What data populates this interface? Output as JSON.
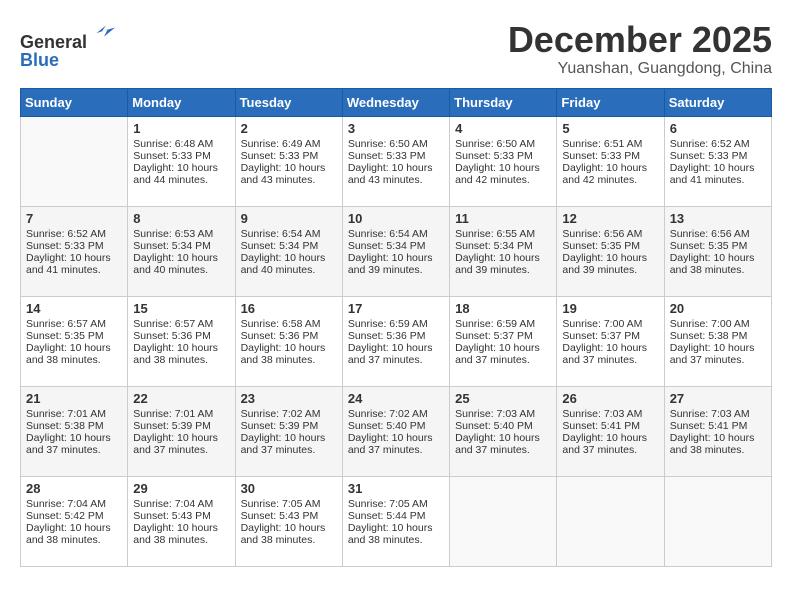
{
  "header": {
    "logo_line1": "General",
    "logo_line2": "Blue",
    "month": "December 2025",
    "location": "Yuanshan, Guangdong, China"
  },
  "weekdays": [
    "Sunday",
    "Monday",
    "Tuesday",
    "Wednesday",
    "Thursday",
    "Friday",
    "Saturday"
  ],
  "weeks": [
    [
      {
        "day": "",
        "info": ""
      },
      {
        "day": "1",
        "info": "Sunrise: 6:48 AM\nSunset: 5:33 PM\nDaylight: 10 hours\nand 44 minutes."
      },
      {
        "day": "2",
        "info": "Sunrise: 6:49 AM\nSunset: 5:33 PM\nDaylight: 10 hours\nand 43 minutes."
      },
      {
        "day": "3",
        "info": "Sunrise: 6:50 AM\nSunset: 5:33 PM\nDaylight: 10 hours\nand 43 minutes."
      },
      {
        "day": "4",
        "info": "Sunrise: 6:50 AM\nSunset: 5:33 PM\nDaylight: 10 hours\nand 42 minutes."
      },
      {
        "day": "5",
        "info": "Sunrise: 6:51 AM\nSunset: 5:33 PM\nDaylight: 10 hours\nand 42 minutes."
      },
      {
        "day": "6",
        "info": "Sunrise: 6:52 AM\nSunset: 5:33 PM\nDaylight: 10 hours\nand 41 minutes."
      }
    ],
    [
      {
        "day": "7",
        "info": "Sunrise: 6:52 AM\nSunset: 5:33 PM\nDaylight: 10 hours\nand 41 minutes."
      },
      {
        "day": "8",
        "info": "Sunrise: 6:53 AM\nSunset: 5:34 PM\nDaylight: 10 hours\nand 40 minutes."
      },
      {
        "day": "9",
        "info": "Sunrise: 6:54 AM\nSunset: 5:34 PM\nDaylight: 10 hours\nand 40 minutes."
      },
      {
        "day": "10",
        "info": "Sunrise: 6:54 AM\nSunset: 5:34 PM\nDaylight: 10 hours\nand 39 minutes."
      },
      {
        "day": "11",
        "info": "Sunrise: 6:55 AM\nSunset: 5:34 PM\nDaylight: 10 hours\nand 39 minutes."
      },
      {
        "day": "12",
        "info": "Sunrise: 6:56 AM\nSunset: 5:35 PM\nDaylight: 10 hours\nand 39 minutes."
      },
      {
        "day": "13",
        "info": "Sunrise: 6:56 AM\nSunset: 5:35 PM\nDaylight: 10 hours\nand 38 minutes."
      }
    ],
    [
      {
        "day": "14",
        "info": "Sunrise: 6:57 AM\nSunset: 5:35 PM\nDaylight: 10 hours\nand 38 minutes."
      },
      {
        "day": "15",
        "info": "Sunrise: 6:57 AM\nSunset: 5:36 PM\nDaylight: 10 hours\nand 38 minutes."
      },
      {
        "day": "16",
        "info": "Sunrise: 6:58 AM\nSunset: 5:36 PM\nDaylight: 10 hours\nand 38 minutes."
      },
      {
        "day": "17",
        "info": "Sunrise: 6:59 AM\nSunset: 5:36 PM\nDaylight: 10 hours\nand 37 minutes."
      },
      {
        "day": "18",
        "info": "Sunrise: 6:59 AM\nSunset: 5:37 PM\nDaylight: 10 hours\nand 37 minutes."
      },
      {
        "day": "19",
        "info": "Sunrise: 7:00 AM\nSunset: 5:37 PM\nDaylight: 10 hours\nand 37 minutes."
      },
      {
        "day": "20",
        "info": "Sunrise: 7:00 AM\nSunset: 5:38 PM\nDaylight: 10 hours\nand 37 minutes."
      }
    ],
    [
      {
        "day": "21",
        "info": "Sunrise: 7:01 AM\nSunset: 5:38 PM\nDaylight: 10 hours\nand 37 minutes."
      },
      {
        "day": "22",
        "info": "Sunrise: 7:01 AM\nSunset: 5:39 PM\nDaylight: 10 hours\nand 37 minutes."
      },
      {
        "day": "23",
        "info": "Sunrise: 7:02 AM\nSunset: 5:39 PM\nDaylight: 10 hours\nand 37 minutes."
      },
      {
        "day": "24",
        "info": "Sunrise: 7:02 AM\nSunset: 5:40 PM\nDaylight: 10 hours\nand 37 minutes."
      },
      {
        "day": "25",
        "info": "Sunrise: 7:03 AM\nSunset: 5:40 PM\nDaylight: 10 hours\nand 37 minutes."
      },
      {
        "day": "26",
        "info": "Sunrise: 7:03 AM\nSunset: 5:41 PM\nDaylight: 10 hours\nand 37 minutes."
      },
      {
        "day": "27",
        "info": "Sunrise: 7:03 AM\nSunset: 5:41 PM\nDaylight: 10 hours\nand 38 minutes."
      }
    ],
    [
      {
        "day": "28",
        "info": "Sunrise: 7:04 AM\nSunset: 5:42 PM\nDaylight: 10 hours\nand 38 minutes."
      },
      {
        "day": "29",
        "info": "Sunrise: 7:04 AM\nSunset: 5:43 PM\nDaylight: 10 hours\nand 38 minutes."
      },
      {
        "day": "30",
        "info": "Sunrise: 7:05 AM\nSunset: 5:43 PM\nDaylight: 10 hours\nand 38 minutes."
      },
      {
        "day": "31",
        "info": "Sunrise: 7:05 AM\nSunset: 5:44 PM\nDaylight: 10 hours\nand 38 minutes."
      },
      {
        "day": "",
        "info": ""
      },
      {
        "day": "",
        "info": ""
      },
      {
        "day": "",
        "info": ""
      }
    ]
  ]
}
